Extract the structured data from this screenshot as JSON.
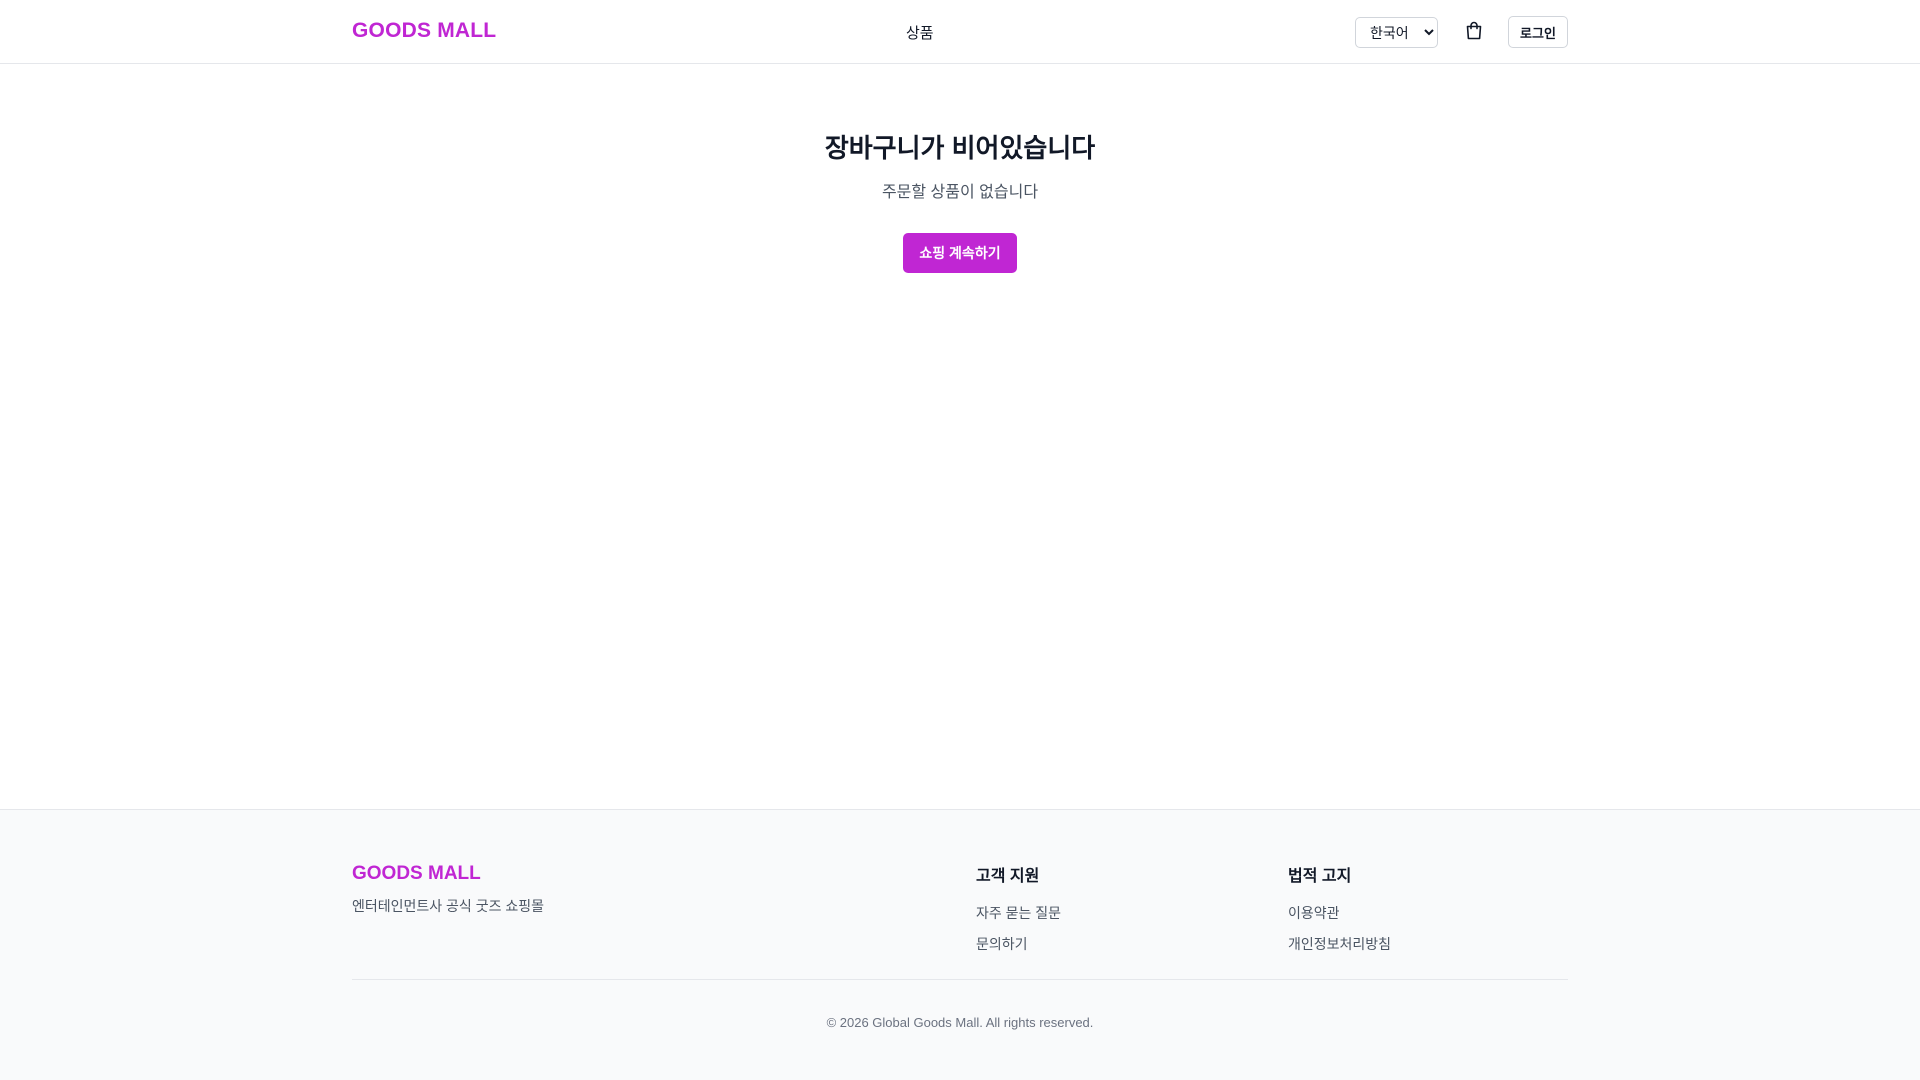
{
  "header": {
    "brand": "GOODS MALL",
    "nav": {
      "products_label": "상품"
    },
    "language": {
      "selected": "한국어"
    },
    "cart_icon": "shopping-bag-icon",
    "login_label": "로그인"
  },
  "main": {
    "title": "장바구니가 비어있습니다",
    "subtitle": "주문할 상품이 없습니다",
    "continue_label": "쇼핑 계속하기"
  },
  "footer": {
    "brand": "GOODS MALL",
    "description": "엔터테인먼트사 공식 굿즈 쇼핑몰",
    "support": {
      "heading": "고객 지원",
      "links": [
        "자주 묻는 질문",
        "문의하기"
      ]
    },
    "legal": {
      "heading": "법적 고지",
      "links": [
        "이용약관",
        "개인정보처리방침"
      ]
    },
    "copyright": "© 2026 Global Goods Mall. All rights reserved."
  },
  "colors": {
    "accent": "#c026d3",
    "text": "#111827",
    "muted": "#4b5563",
    "border": "#e5e7eb",
    "footer_bg": "#f9fafb"
  }
}
